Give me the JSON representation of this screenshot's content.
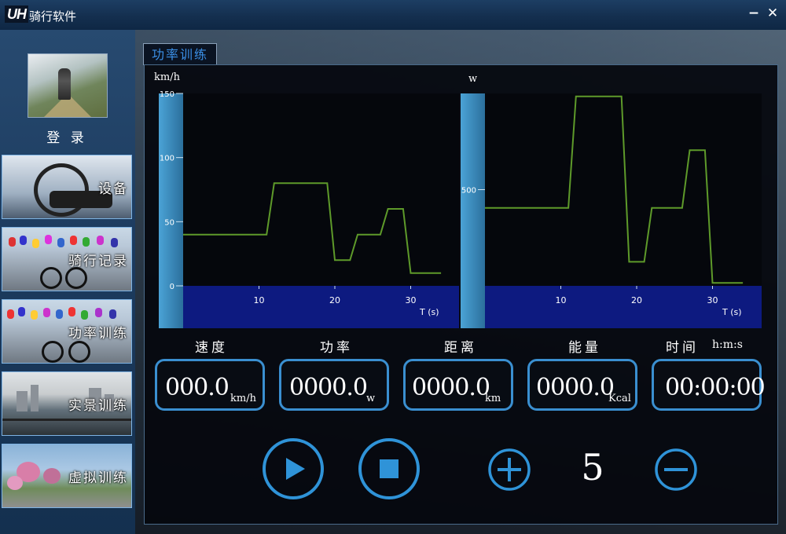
{
  "app": {
    "logo": "UH",
    "title": "骑行软件"
  },
  "window_controls": {
    "minimize": "−",
    "close": "✕"
  },
  "sidebar": {
    "login_label": "登 录",
    "items": [
      {
        "label": "设备"
      },
      {
        "label": "骑行记录"
      },
      {
        "label": "功率训练"
      },
      {
        "label": "实景训练"
      },
      {
        "label": "虚拟训练"
      }
    ]
  },
  "tab": {
    "label": "功率训练"
  },
  "metrics": {
    "speed": {
      "title": "速度",
      "value": "000.0",
      "unit": "km/h"
    },
    "power": {
      "title": "功率",
      "value": "0000.0",
      "unit": "w"
    },
    "distance": {
      "title": "距离",
      "value": "0000.0",
      "unit": "km"
    },
    "energy": {
      "title": "能量",
      "value": "0000.0",
      "unit": "Kcal"
    },
    "time": {
      "title": "时间",
      "value": "00:00:00",
      "unit": "h:m:s"
    }
  },
  "controls": {
    "level": "5"
  },
  "colors": {
    "accent": "#3a8fd0",
    "line": "#5e9a2a",
    "axis_band": "#0d1a80"
  },
  "chart_data": [
    {
      "type": "line",
      "ylabel": "km/h",
      "xlabel": "T (s)",
      "xlim": [
        0,
        37
      ],
      "ylim": [
        0,
        150
      ],
      "y_ticks": [
        0,
        50,
        100,
        150
      ],
      "x_ticks": [
        10,
        20,
        30
      ],
      "series": [
        {
          "x": [
            0,
            11,
            12,
            19,
            20,
            22,
            23,
            26,
            27,
            29,
            30,
            34
          ],
          "y": [
            40,
            40,
            80,
            80,
            20,
            20,
            40,
            40,
            60,
            60,
            10,
            10
          ]
        }
      ]
    },
    {
      "type": "line",
      "ylabel": "w",
      "xlabel": "T (s)",
      "xlim": [
        0,
        37
      ],
      "ylim": [
        0,
        1000
      ],
      "y_ticks": [
        500
      ],
      "x_ticks": [
        10,
        20,
        30
      ],
      "series": [
        {
          "x": [
            0,
            11,
            12,
            18,
            19,
            21,
            22,
            26,
            27,
            29,
            30,
            34
          ],
          "y": [
            405,
            405,
            985,
            985,
            125,
            125,
            405,
            405,
            705,
            705,
            15,
            15
          ]
        }
      ]
    }
  ]
}
